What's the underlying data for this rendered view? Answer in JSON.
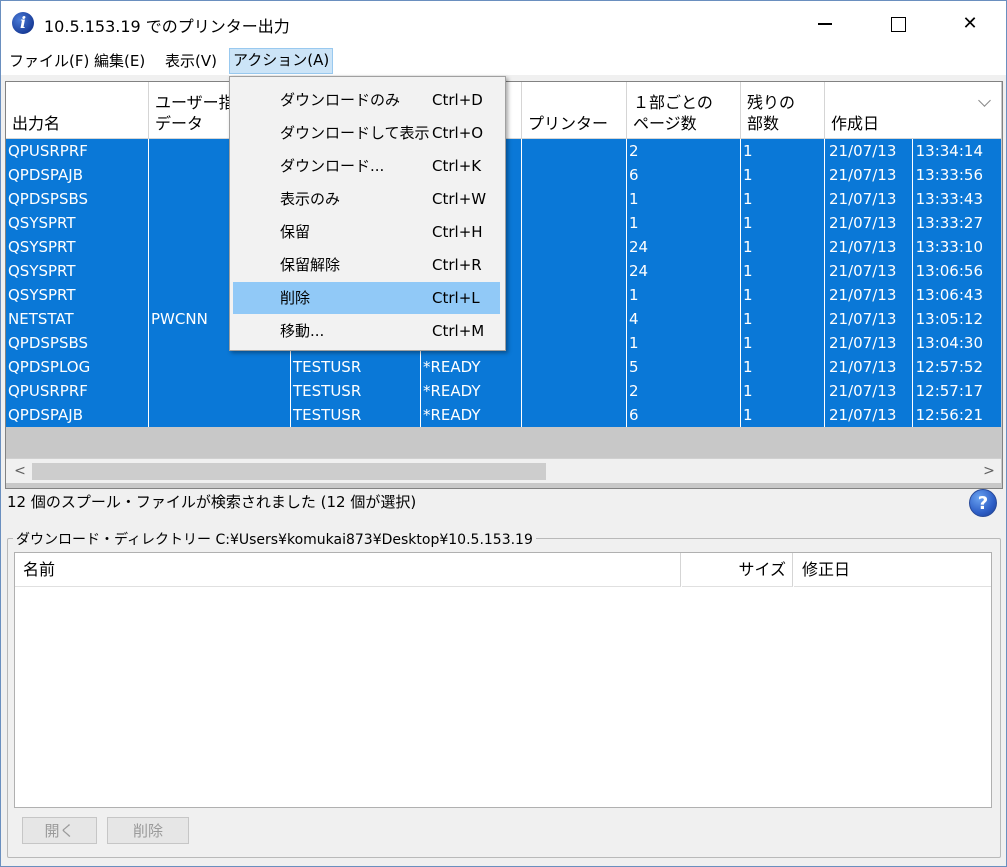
{
  "window": {
    "title": "10.5.153.19 でのプリンター出力",
    "app_icon_letter": "i",
    "min_glyph": "",
    "close_glyph": "✕"
  },
  "menubar": [
    "ファイル(F)",
    "編集(E)",
    "表示(V)",
    "アクション(A)"
  ],
  "action_menu": [
    {
      "label": "ダウンロードのみ",
      "shortcut": "Ctrl+D"
    },
    {
      "label": "ダウンロードして表示",
      "shortcut": "Ctrl+O"
    },
    {
      "label": "ダウンロード...",
      "shortcut": "Ctrl+K"
    },
    {
      "label": "表示のみ",
      "shortcut": "Ctrl+W"
    },
    {
      "label": "保留",
      "shortcut": "Ctrl+H"
    },
    {
      "label": "保留解除",
      "shortcut": "Ctrl+R"
    },
    {
      "label": "削除",
      "shortcut": "Ctrl+L"
    },
    {
      "label": "移動...",
      "shortcut": "Ctrl+M"
    }
  ],
  "table": {
    "columns": [
      "出力名",
      "ユーザー指\nデータ",
      "",
      "",
      "プリンター",
      "１部ごとの\nページ数",
      "残りの\n部数",
      "作成日"
    ],
    "rows": [
      [
        "QPUSRPRF",
        "",
        "",
        "",
        "",
        "2",
        "1",
        "21/07/13",
        "13:34:14"
      ],
      [
        "QPDSPAJB",
        "",
        "",
        "",
        "",
        "6",
        "1",
        "21/07/13",
        "13:33:56"
      ],
      [
        "QPDSPSBS",
        "",
        "",
        "",
        "",
        "1",
        "1",
        "21/07/13",
        "13:33:43"
      ],
      [
        "QSYSPRT",
        "",
        "",
        "",
        "",
        "1",
        "1",
        "21/07/13",
        "13:33:27"
      ],
      [
        "QSYSPRT",
        "",
        "",
        "",
        "",
        "24",
        "1",
        "21/07/13",
        "13:33:10"
      ],
      [
        "QSYSPRT",
        "",
        "",
        "",
        "",
        "24",
        "1",
        "21/07/13",
        "13:06:56"
      ],
      [
        "QSYSPRT",
        "",
        "",
        "",
        "",
        "1",
        "1",
        "21/07/13",
        "13:06:43"
      ],
      [
        "NETSTAT",
        "PWCNN",
        "",
        "",
        "",
        "4",
        "1",
        "21/07/13",
        "13:05:12"
      ],
      [
        "QPDSPSBS",
        "",
        "",
        "",
        "",
        "1",
        "1",
        "21/07/13",
        "13:04:30"
      ],
      [
        "QPDSPLOG",
        "",
        "TESTUSR",
        "*READY",
        "",
        "5",
        "1",
        "21/07/13",
        "12:57:52"
      ],
      [
        "QPUSRPRF",
        "",
        "TESTUSR",
        "*READY",
        "",
        "2",
        "1",
        "21/07/13",
        "12:57:17"
      ],
      [
        "QPDSPAJB",
        "",
        "TESTUSR",
        "*READY",
        "",
        "6",
        "1",
        "21/07/13",
        "12:56:21"
      ]
    ],
    "selection_color": "#0a78d7"
  },
  "scrollbar": {
    "left_arrow": "<",
    "right_arrow": ">"
  },
  "status_text": "12 個のスプール・ファイルが検索されました (12 個が選択)",
  "help_glyph": "?",
  "download_dir": {
    "label": "ダウンロード・ディレクトリー C:¥Users¥komukai873¥Desktop¥10.5.153.19",
    "columns": [
      "名前",
      "サイズ",
      "修正日"
    ]
  },
  "buttons": {
    "open": "開く",
    "delete": "削除"
  },
  "icons": [
    "app-info-icon",
    "minimize-icon",
    "maximize-icon",
    "close-icon",
    "sort-chevron-icon",
    "help-icon"
  ]
}
